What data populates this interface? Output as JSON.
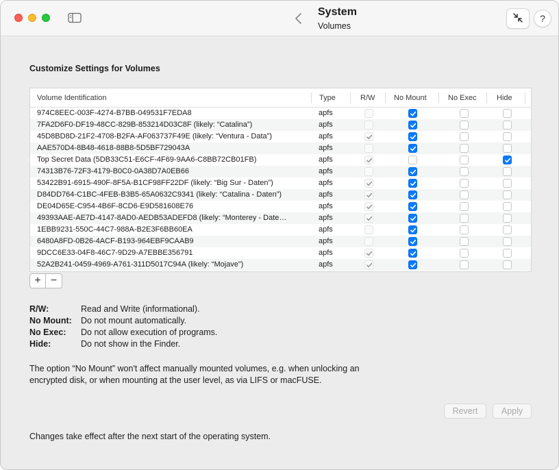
{
  "window": {
    "title": "System",
    "subtitle": "Volumes",
    "help_label": "?"
  },
  "section_title": "Customize Settings for Volumes",
  "table": {
    "columns": {
      "name": "Volume Identification",
      "type": "Type",
      "rw": "R/W",
      "no_mount": "No Mount",
      "no_exec": "No Exec",
      "hide": "Hide"
    },
    "rows": [
      {
        "name": "974C8EEC-003F-4274-B7BB-049531F7EDA8",
        "type": "apfs",
        "rw": "disabled",
        "no_mount": true,
        "no_exec": false,
        "hide": false
      },
      {
        "name": "7FA2D6F0-DF19-48CC-829B-853214D03C8F (likely: “Catalina”)",
        "type": "apfs",
        "rw": "disabled",
        "no_mount": true,
        "no_exec": false,
        "hide": false
      },
      {
        "name": "45D8BD8D-21F2-4708-B2FA-AF063737F49E (likely: “Ventura - Data”)",
        "type": "apfs",
        "rw": "checked",
        "no_mount": true,
        "no_exec": false,
        "hide": false
      },
      {
        "name": "AAE570D4-8B48-4618-88B8-5D5BF729043A",
        "type": "apfs",
        "rw": "disabled",
        "no_mount": true,
        "no_exec": false,
        "hide": false
      },
      {
        "name": "Top Secret Data (5DB33C51-E6CF-4F69-9AA6-C8BB72CB01FB)",
        "type": "apfs",
        "rw": "checked",
        "no_mount": false,
        "no_exec": false,
        "hide": true
      },
      {
        "name": "74313B76-72F3-4179-B0C0-0A38D7A0EB66",
        "type": "apfs",
        "rw": "disabled",
        "no_mount": true,
        "no_exec": false,
        "hide": false
      },
      {
        "name": "53422B91-6915-490F-8F5A-B1CF98FF22DF (likely: “Big Sur - Daten”)",
        "type": "apfs",
        "rw": "checked",
        "no_mount": true,
        "no_exec": false,
        "hide": false
      },
      {
        "name": "D84DD764-C1BC-4FEB-B3B5-65A0632C9341 (likely: “Catalina - Daten”)",
        "type": "apfs",
        "rw": "checked",
        "no_mount": true,
        "no_exec": false,
        "hide": false
      },
      {
        "name": "DE04D65E-C954-4B6F-8CD6-E9D581608E76",
        "type": "apfs",
        "rw": "checked",
        "no_mount": true,
        "no_exec": false,
        "hide": false
      },
      {
        "name": "49393AAE-AE7D-4147-8AD0-AEDB53ADEFD8 (likely: “Monterey - Date…",
        "type": "apfs",
        "rw": "checked",
        "no_mount": true,
        "no_exec": false,
        "hide": false
      },
      {
        "name": "1EBB9231-550C-44C7-988A-B2E3F6BB60EA",
        "type": "apfs",
        "rw": "disabled",
        "no_mount": true,
        "no_exec": false,
        "hide": false
      },
      {
        "name": "6480A8FD-0B26-4ACF-B193-964EBF9CAAB9",
        "type": "apfs",
        "rw": "disabled",
        "no_mount": true,
        "no_exec": false,
        "hide": false
      },
      {
        "name": "9DCC6E33-04F8-46C7-9D29-A7EBBE356791",
        "type": "apfs",
        "rw": "checked",
        "no_mount": true,
        "no_exec": false,
        "hide": false
      },
      {
        "name": "52A2B241-0459-4969-A761-311D5017C94A (likely: “Mojave”)",
        "type": "apfs",
        "rw": "checked",
        "no_mount": true,
        "no_exec": false,
        "hide": false
      }
    ]
  },
  "controls": {
    "add_label": "+",
    "remove_label": "−"
  },
  "legend": [
    {
      "key": "R/W:",
      "value": "Read and Write (informational)."
    },
    {
      "key": "No Mount:",
      "value": "Do not mount automatically."
    },
    {
      "key": "No Exec:",
      "value": "Do not allow execution of programs."
    },
    {
      "key": "Hide:",
      "value": "Do not show in the Finder."
    }
  ],
  "note": "The option “No Mount” won't affect manually mounted volumes, e.g. when unlocking an encrypted disk, or when mounting at the user level, as via LIFS or macFUSE.",
  "buttons": {
    "revert": "Revert",
    "apply": "Apply"
  },
  "footer_note": "Changes take effect after the next start of the operating system.",
  "colors": {
    "accent": "#0a7aff",
    "close": "#fe5f57",
    "minimize": "#febc2e",
    "maximize": "#28c840"
  },
  "icons": {
    "sidebar_toggle": "sidebar-icon",
    "back": "chevron-left-icon",
    "collapse": "arrows-collapse-icon",
    "help": "help-icon"
  }
}
